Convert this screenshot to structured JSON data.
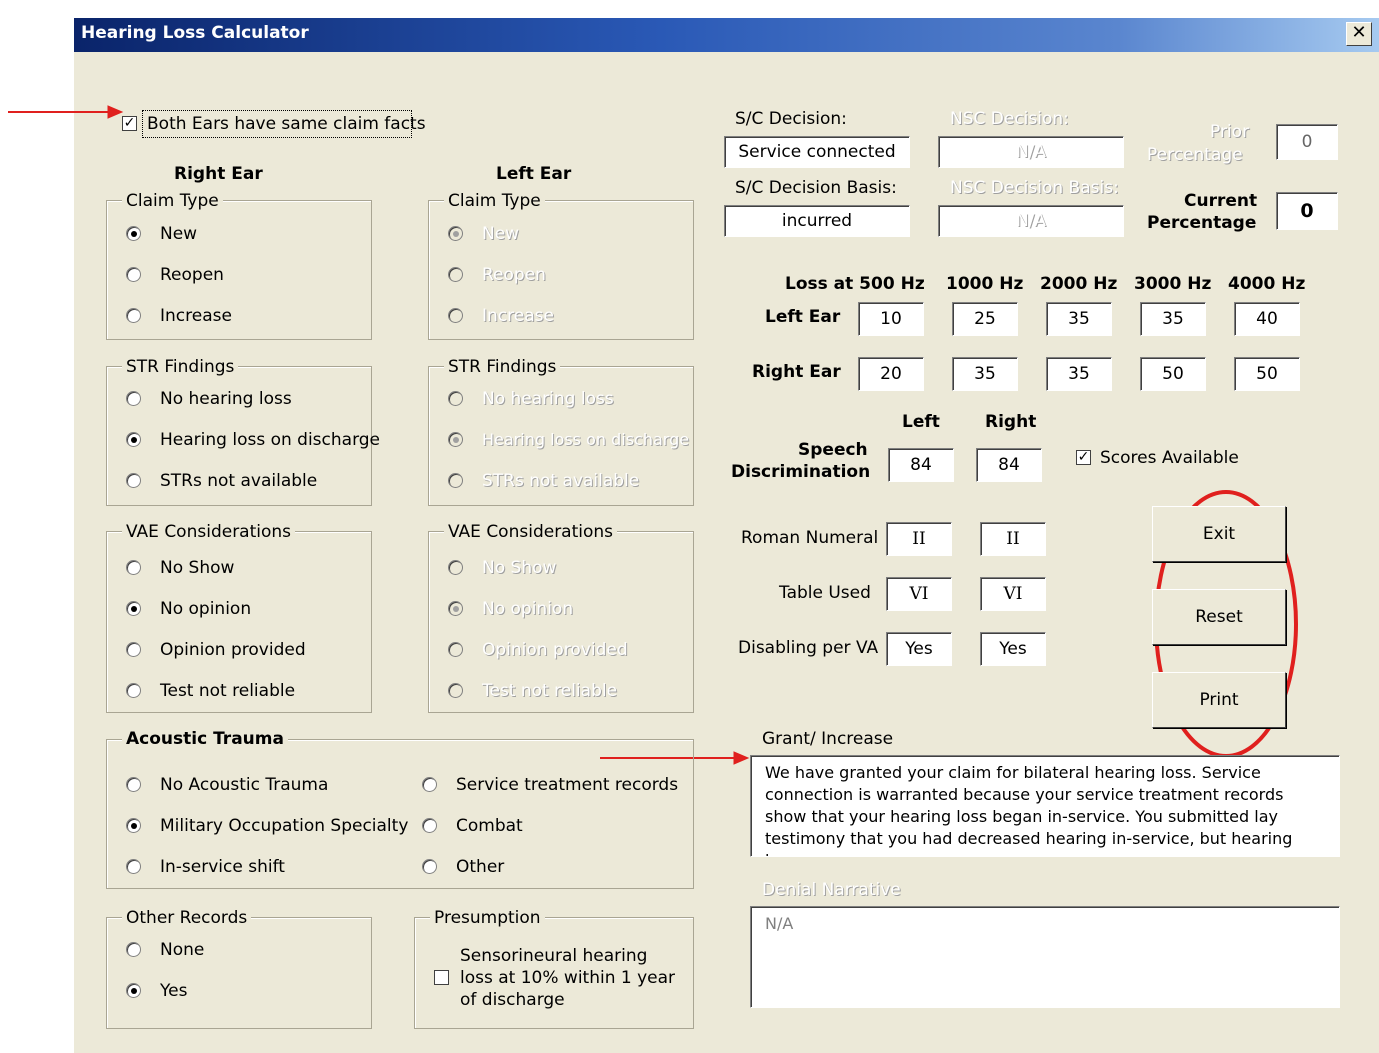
{
  "window": {
    "title": "Hearing Loss Calculator",
    "close_glyph": "✕"
  },
  "same_facts": {
    "label": "Both Ears have same claim facts",
    "checked": true
  },
  "right_ear": {
    "heading": "Right Ear",
    "claim_type": {
      "legend": "Claim Type",
      "options": [
        "New",
        "Reopen",
        "Increase"
      ],
      "selected": "New"
    },
    "str_findings": {
      "legend": "STR Findings",
      "options": [
        "No hearing loss",
        "Hearing loss on discharge",
        "STRs not available"
      ],
      "selected": "Hearing loss on discharge"
    },
    "vae": {
      "legend": "VAE Considerations",
      "options": [
        "No Show",
        "No opinion",
        "Opinion provided",
        "Test not reliable"
      ],
      "selected": "No opinion"
    }
  },
  "left_ear": {
    "heading": "Left Ear",
    "claim_type": {
      "legend": "Claim Type",
      "options": [
        "New",
        "Reopen",
        "Increase"
      ],
      "selected": "New"
    },
    "str_findings": {
      "legend": "STR Findings",
      "options": [
        "No hearing loss",
        "Hearing loss on discharge",
        "STRs not available"
      ],
      "selected": "Hearing loss on discharge"
    },
    "vae": {
      "legend": "VAE Considerations",
      "options": [
        "No Show",
        "No opinion",
        "Opinion provided",
        "Test not reliable"
      ],
      "selected": "No opinion"
    }
  },
  "acoustic_trauma": {
    "legend": "Acoustic Trauma",
    "options": [
      "No Acoustic Trauma",
      "Military Occupation Specialty",
      "In-service shift",
      "Service treatment records",
      "Combat",
      "Other"
    ],
    "selected": "Military Occupation Specialty"
  },
  "other_records": {
    "legend": "Other Records",
    "options": [
      "None",
      "Yes"
    ],
    "selected": "Yes"
  },
  "presumption": {
    "legend": "Presumption",
    "line1": "Sensorineural hearing",
    "line2": "loss at 10% within 1 year",
    "line3": "of discharge",
    "checked": false
  },
  "decision": {
    "sc_label": "S/C Decision:",
    "sc_value": "Service connected",
    "nsc_label": "NSC Decision:",
    "nsc_value": "N/A",
    "sc_basis_label": "S/C Decision Basis:",
    "sc_basis_value": "incurred",
    "nsc_basis_label": "NSC Decision Basis:",
    "nsc_basis_value": "N/A",
    "prior_label_1": "Prior",
    "prior_label_2": "Percentage",
    "prior_value": "0",
    "current_label_1": "Current",
    "current_label_2": "Percentage",
    "current_value": "0"
  },
  "audiometry": {
    "frequencies": [
      "Loss at 500 Hz",
      "1000 Hz",
      "2000 Hz",
      "3000 Hz",
      "4000 Hz"
    ],
    "left_label": "Left Ear",
    "left_values": [
      "10",
      "25",
      "35",
      "35",
      "40"
    ],
    "right_label": "Right Ear",
    "right_values": [
      "20",
      "35",
      "35",
      "50",
      "50"
    ]
  },
  "speech": {
    "col_left": "Left",
    "col_right": "Right",
    "label_1": "Speech",
    "label_2": "Discrimination",
    "left_value": "84",
    "right_value": "84",
    "scores_label": "Scores Available",
    "scores_checked": true
  },
  "results": {
    "roman_label": "Roman Numeral",
    "roman_left": "II",
    "roman_right": "II",
    "table_label": "Table Used",
    "table_left": "VI",
    "table_right": "VI",
    "disabling_label": "Disabling per VA",
    "disabling_left": "Yes",
    "disabling_right": "Yes"
  },
  "buttons": {
    "exit": "Exit",
    "reset": "Reset",
    "print": "Print"
  },
  "grant": {
    "label": "Grant/ Increase",
    "text": "We have granted your claim for bilateral hearing loss. Service connection is warranted because your service treatment records show that your hearing loss began in-service.   You submitted lay testimony that you had decreased hearing in-service, but hearing loss"
  },
  "denial": {
    "label": "Denial Narrative",
    "text": "N/A"
  },
  "annotation_color": "#e0201e"
}
